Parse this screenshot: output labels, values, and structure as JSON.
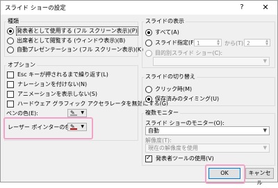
{
  "window": {
    "title": "スライド ショーの設定",
    "help_glyph": "?",
    "close_glyph": "✕"
  },
  "show_type": {
    "label": "種類",
    "options": [
      {
        "label": "発表者として使用する (フル スクリーン表示)(P)",
        "selected": true
      },
      {
        "label": "出席者として閲覧する (ウィンドウ表示)(B)",
        "selected": false
      },
      {
        "label": "自動プレゼンテーション (フル スクリーン表示)(K)",
        "selected": false
      }
    ]
  },
  "options": {
    "label": "オプション",
    "checks": [
      {
        "label": "Esc キーが押されるまで繰り返す(L)",
        "checked": false
      },
      {
        "label": "ナレーションを付けない(N)",
        "checked": false
      },
      {
        "label": "アニメーションを表示しない(S)",
        "checked": false
      },
      {
        "label": "ハードウェア グラフィック アクセラレータを無効にする(G)",
        "checked": false
      }
    ],
    "pen_color_label": "ペンの色(E):",
    "laser_color_label": "レーザー ポインターの色(R):",
    "pen_color": "#ffffff",
    "laser_color": "#d00000"
  },
  "show_slides": {
    "label": "スライドの表示",
    "all_label": "すべて(A)",
    "from_label": "スライド指定(F):",
    "from_value": "1",
    "to_label": "から(T):",
    "to_value": "2",
    "custom_label": "目的別スライド ショー(C):",
    "custom_value": ""
  },
  "advance": {
    "label": "スライドの切り替え",
    "options": [
      {
        "label": "クリック時(M)",
        "selected": false
      },
      {
        "label": "保存済みのタイミング(U)",
        "selected": true
      }
    ]
  },
  "monitors": {
    "label": "複数モニター",
    "monitor_label": "スライド ショーのモニター(O):",
    "monitor_value": "自動",
    "resolution_label": "解像度(T):",
    "resolution_value": "現在の解像度を使用",
    "presenter_view_label": "発表者ツールの使用(V)",
    "presenter_view_checked": true
  },
  "buttons": {
    "ok": "OK",
    "cancel": "キャンセル"
  },
  "colors": {
    "highlight": "#f3a3c7",
    "focus_blue": "#0078d7"
  }
}
